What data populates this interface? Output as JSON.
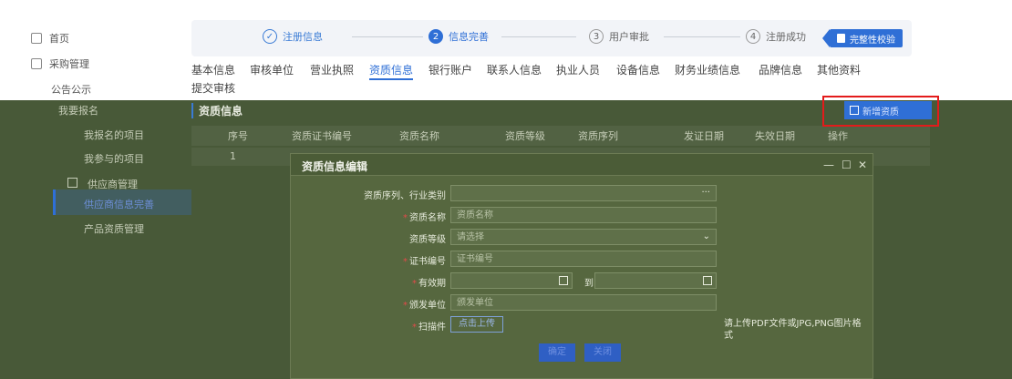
{
  "sidebar": {
    "items": [
      {
        "label": "首页",
        "icon": "home-icon"
      },
      {
        "label": "采购管理",
        "icon": "folder-icon"
      },
      {
        "label": "公告公示"
      },
      {
        "label": "我要报名"
      },
      {
        "label": "我报名的项目"
      },
      {
        "label": "我参与的项目"
      },
      {
        "label": "供应商管理",
        "icon": "vendor-icon"
      },
      {
        "label": "供应商信息完善"
      },
      {
        "label": "产品资质管理"
      }
    ]
  },
  "steps": [
    {
      "num": "✓",
      "label": "注册信息",
      "state": "done"
    },
    {
      "num": "2",
      "label": "信息完善",
      "state": "active"
    },
    {
      "num": "3",
      "label": "用户审批",
      "state": "todo"
    },
    {
      "num": "4",
      "label": "注册成功",
      "state": "todo"
    }
  ],
  "verify_button": "完整性校验",
  "tabs": [
    "基本信息",
    "审核单位",
    "营业执照",
    "资质信息",
    "银行账户",
    "联系人信息",
    "执业人员",
    "设备信息",
    "财务业绩信息",
    "品牌信息",
    "其他资料"
  ],
  "active_tab": "资质信息",
  "submit_tab": "提交审核",
  "section_title": "资质信息",
  "add_button": "新增资质",
  "table": {
    "headers": [
      "序号",
      "资质证书编号",
      "资质名称",
      "资质等级",
      "资质序列",
      "发证日期",
      "失效日期",
      "操作"
    ],
    "rows": [
      [
        "1"
      ]
    ]
  },
  "dialog": {
    "title": "资质信息编辑",
    "controls": [
      "—",
      "☐",
      "✕"
    ],
    "fields": [
      {
        "label": "资质序列、行业类别",
        "required": false,
        "placeholder": "",
        "suffix": "···"
      },
      {
        "label": "资质名称",
        "required": true,
        "placeholder": "资质名称",
        "suffix": ""
      },
      {
        "label": "资质等级",
        "required": false,
        "placeholder": "请选择",
        "suffix": "⌄"
      },
      {
        "label": "证书编号",
        "required": true,
        "placeholder": "证书编号",
        "suffix": ""
      },
      {
        "label": "有效期",
        "required": true,
        "placeholder": "",
        "suffix": ""
      },
      {
        "label": "颁发单位",
        "required": true,
        "placeholder": "颁发单位",
        "suffix": ""
      },
      {
        "label": "扫描件",
        "required": true,
        "placeholder": "",
        "suffix": ""
      }
    ],
    "date_to": "到",
    "upload_button": "点击上传",
    "upload_hint": "请上传PDF文件或JPG,PNG图片格式",
    "confirm_button": "确定",
    "close_button": "关闭"
  }
}
